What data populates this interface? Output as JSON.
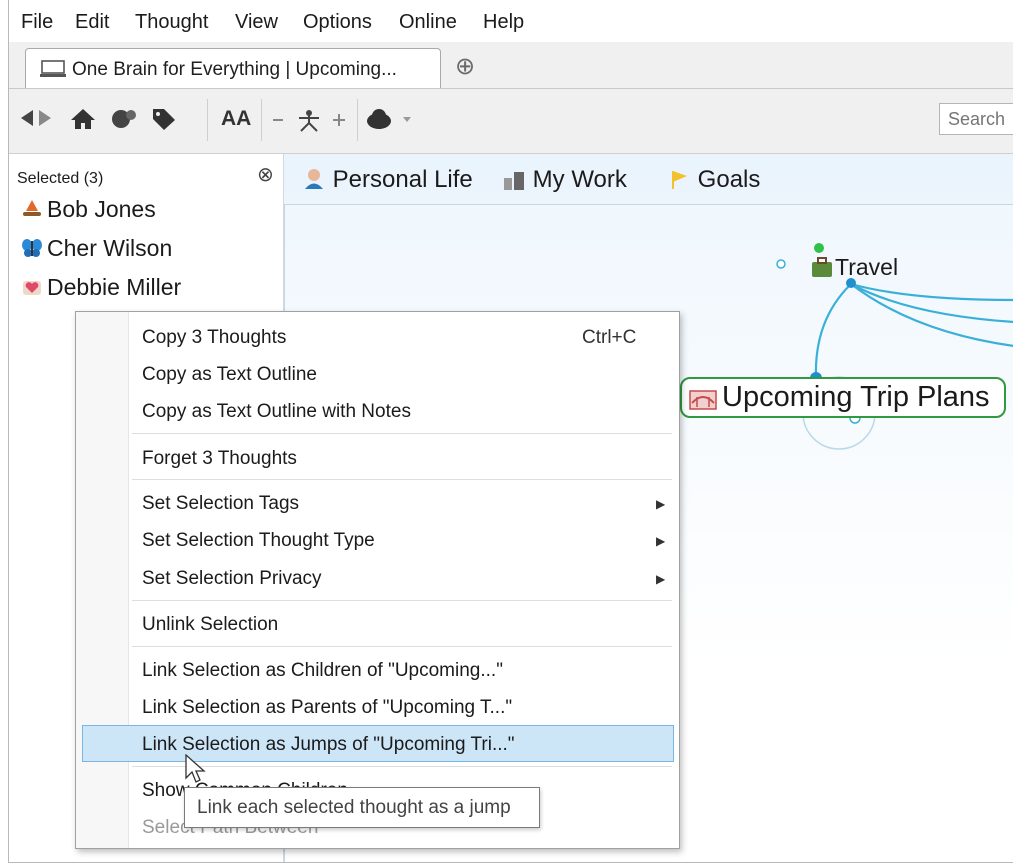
{
  "menubar": [
    "File",
    "Edit",
    "Thought",
    "View",
    "Options",
    "Online",
    "Help"
  ],
  "tab": {
    "title": "One Brain for Everything | Upcoming...",
    "new_tab_symbol": "⊕"
  },
  "toolbar": {
    "font_label": "AA",
    "search_placeholder": "Search",
    "icons": [
      "back-forward-icon",
      "home-icon",
      "brain-icon",
      "tag-icon",
      "font-size-icon",
      "layout-icon",
      "cloud-icon"
    ]
  },
  "selected_panel": {
    "title": "Selected (3)",
    "close_symbol": "⊗",
    "items": [
      "Bob Jones",
      "Cher Wilson",
      "Debbie Miller"
    ]
  },
  "pins": [
    "Personal Life",
    "My Work",
    "Goals"
  ],
  "plex": {
    "parent": "Travel",
    "active": "Upcoming Trip Plans"
  },
  "context_menu": {
    "copy": "Copy 3 Thoughts",
    "copy_shortcut": "Ctrl+C",
    "copy_outline": "Copy as Text Outline",
    "copy_outline_notes": "Copy as Text Outline with Notes",
    "forget": "Forget 3 Thoughts",
    "set_tags": "Set Selection Tags",
    "set_type": "Set Selection Thought Type",
    "set_privacy": "Set Selection Privacy",
    "unlink": "Unlink Selection",
    "link_children": "Link Selection as Children of \"Upcoming...\"",
    "link_parents": "Link Selection as Parents of \"Upcoming T...\"",
    "link_jumps": "Link Selection as Jumps of \"Upcoming Tri...\"",
    "show_partial": "Show",
    "show_tail": "Common Children",
    "select_path": "Select Path Between",
    "submenu_arrow": "▶"
  },
  "tooltip": "Link each selected thought as a jump",
  "colors": {
    "highlight": "#cde6f7",
    "active_node_border": "#2f9a3e",
    "link_line": "#3ab0d8"
  }
}
